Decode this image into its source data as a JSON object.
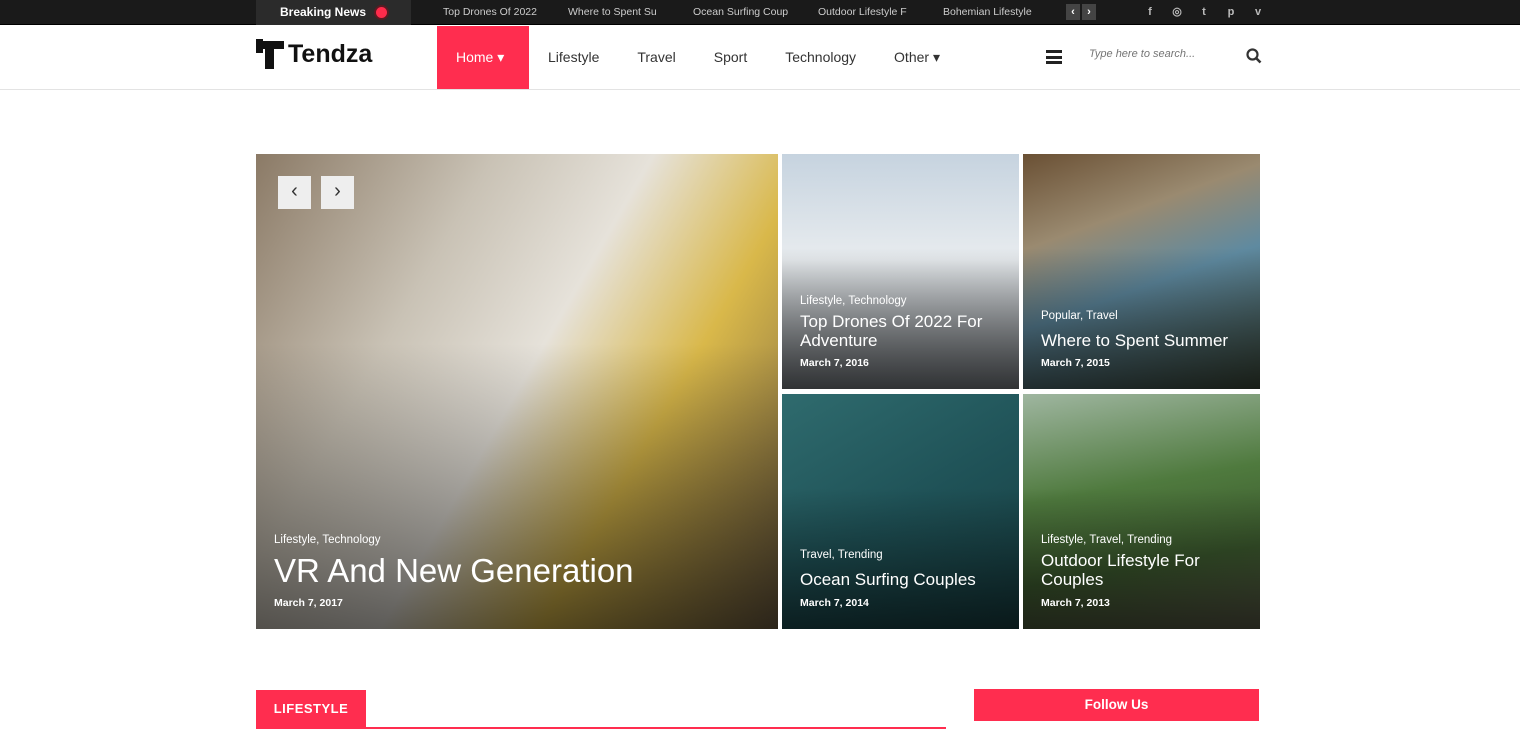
{
  "topbar": {
    "breaking_label": "Breaking News",
    "ticker": [
      "Top Drones Of 2022",
      "Where to Spent Su",
      "Ocean Surfing Coup",
      "Outdoor Lifestyle F",
      "Bohemian Lifestyle"
    ],
    "prev": "‹",
    "next": "›",
    "social": [
      "f",
      "◎",
      "t",
      "p",
      "v"
    ],
    "social_icons": [
      "facebook-icon",
      "instagram-icon",
      "twitter-icon",
      "pinterest-icon",
      "vimeo-icon"
    ]
  },
  "header": {
    "logo": "Tendza",
    "nav": [
      {
        "label": "Home ▾"
      },
      {
        "label": "Lifestyle"
      },
      {
        "label": "Travel"
      },
      {
        "label": "Sport"
      },
      {
        "label": "Technology"
      },
      {
        "label": "Other ▾"
      }
    ],
    "search_placeholder": "Type here to search..."
  },
  "accent": "#ff2d4f",
  "slider": {
    "prev": "‹",
    "next": "›"
  },
  "posts": [
    {
      "category": "Lifestyle, Technology",
      "title": "VR And New Generation",
      "date": "March 7, 2017"
    },
    {
      "category": "Lifestyle, Technology",
      "title": "Top Drones Of 2022 For Adventure",
      "date": "March 7, 2016"
    },
    {
      "category": "Popular, Travel",
      "title": "Where to Spent Summer",
      "date": "March 7, 2015"
    },
    {
      "category": "Travel, Trending",
      "title": "Ocean Surfing Couples",
      "date": "March 7, 2014"
    },
    {
      "category": "Lifestyle, Travel, Trending",
      "title": "Outdoor Lifestyle For Couples",
      "date": "March 7, 2013"
    }
  ],
  "sections": {
    "lifestyle": "LIFESTYLE",
    "follow": "Follow Us"
  }
}
